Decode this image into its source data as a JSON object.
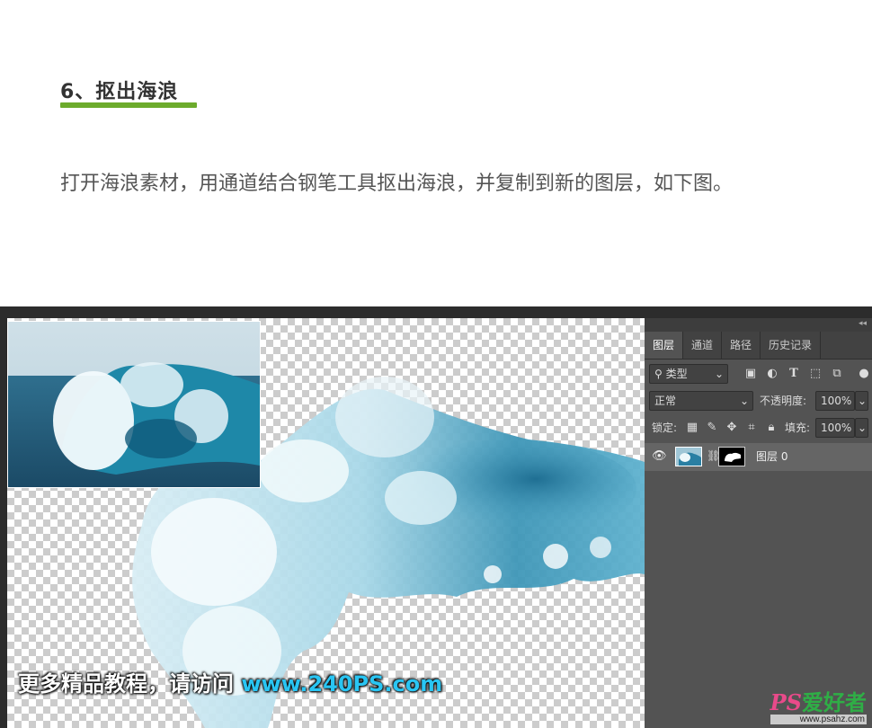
{
  "article": {
    "title": "6、抠出海浪",
    "paragraph": "打开海浪素材，用通道结合钢笔工具抠出海浪，并复制到新的图层，如下图。"
  },
  "photoshop": {
    "tabs": [
      "图层",
      "通道",
      "路径",
      "历史记录"
    ],
    "filter_label": "类型",
    "blend_mode": "正常",
    "opacity_label": "不透明度:",
    "opacity_value": "100%",
    "lock_label": "锁定:",
    "fill_label": "填充:",
    "fill_value": "100%",
    "layer_name": "图层 0"
  },
  "watermark": {
    "text": "更多精品教程，请访问",
    "url": "www.240PS.com"
  },
  "logo": {
    "main": "PS",
    "main_suffix": "爱好者",
    "sub": "www.psahz.com"
  },
  "colors": {
    "accent_underline": "#6cab2c",
    "watermark_url": "#29c5f3",
    "panel_bg": "#535353"
  }
}
